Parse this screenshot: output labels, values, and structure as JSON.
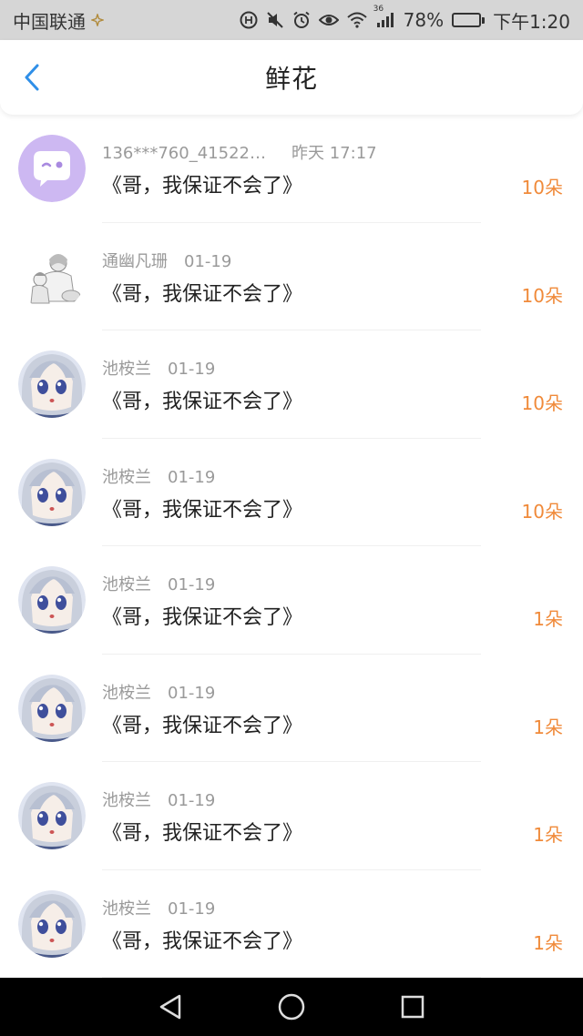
{
  "status_bar": {
    "carrier": "中国联通",
    "network": "36",
    "battery_percent": "78%",
    "battery_level": 0.78,
    "time": "下午1:20"
  },
  "header": {
    "title": "鲜花"
  },
  "colors": {
    "accent_blue": "#2f8fe8",
    "count_orange": "#f08a3a"
  },
  "list": [
    {
      "name": "136***760_415221...",
      "date": "昨天 17:17",
      "title": "《哥，我保证不会了》",
      "count": "10朵",
      "avatar": "chat-bubble-avatar"
    },
    {
      "name": "通幽凡珊",
      "date": "01-19",
      "title": "《哥，我保证不会了》",
      "count": "10朵",
      "avatar": "sketch-avatar"
    },
    {
      "name": "池桉兰",
      "date": "01-19",
      "title": "《哥，我保证不会了》",
      "count": "10朵",
      "avatar": "anime-avatar"
    },
    {
      "name": "池桉兰",
      "date": "01-19",
      "title": "《哥，我保证不会了》",
      "count": "10朵",
      "avatar": "anime-avatar"
    },
    {
      "name": "池桉兰",
      "date": "01-19",
      "title": "《哥，我保证不会了》",
      "count": "1朵",
      "avatar": "anime-avatar"
    },
    {
      "name": "池桉兰",
      "date": "01-19",
      "title": "《哥，我保证不会了》",
      "count": "1朵",
      "avatar": "anime-avatar"
    },
    {
      "name": "池桉兰",
      "date": "01-19",
      "title": "《哥，我保证不会了》",
      "count": "1朵",
      "avatar": "anime-avatar"
    },
    {
      "name": "池桉兰",
      "date": "01-19",
      "title": "《哥，我保证不会了》",
      "count": "1朵",
      "avatar": "anime-avatar"
    }
  ]
}
